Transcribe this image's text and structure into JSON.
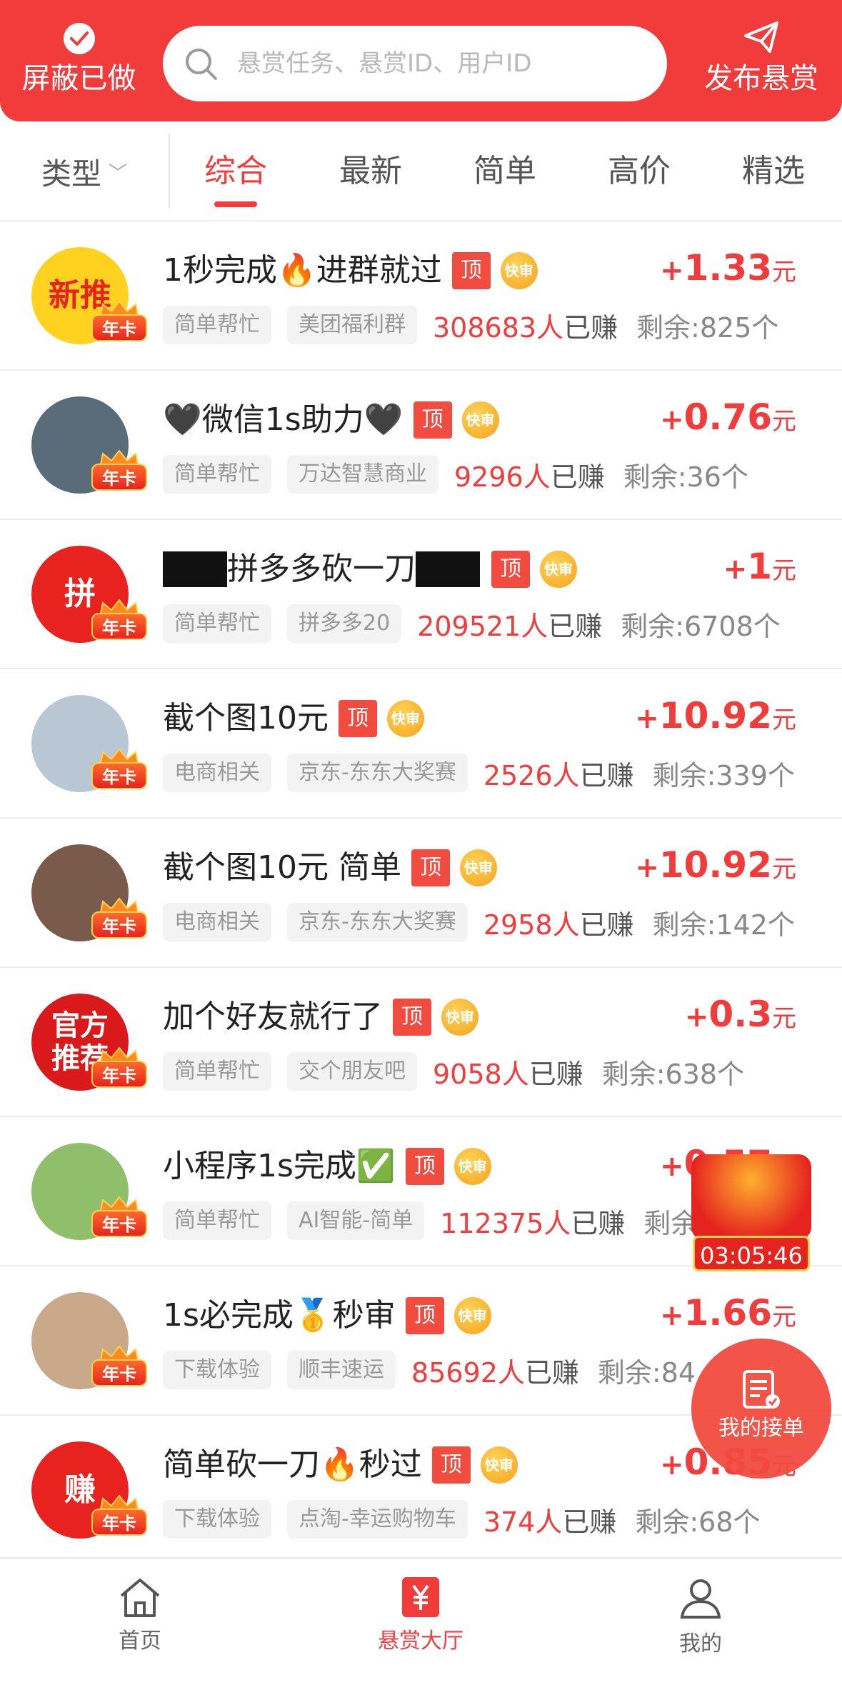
{
  "header": {
    "left_label": "屏蔽已做",
    "search_placeholder": "悬赏任务、悬赏ID、用户ID",
    "right_label": "发布悬赏"
  },
  "filters": {
    "type_label": "类型",
    "tabs": [
      {
        "label": "综合",
        "active": true
      },
      {
        "label": "最新",
        "active": false
      },
      {
        "label": "简单",
        "active": false
      },
      {
        "label": "高价",
        "active": false
      },
      {
        "label": "精选",
        "active": false
      }
    ]
  },
  "badges": {
    "top": "顶",
    "fast": "快审",
    "annual": "年卡"
  },
  "tasks": [
    {
      "title": "1秒完成🔥进群就过",
      "price_plus": "+",
      "price": "1.33",
      "unit": "元",
      "tag1": "简单帮忙",
      "tag2": "美团福利群",
      "earned_count": "308683人",
      "earned_suffix": "已赚",
      "remaining": "剩余:825个",
      "avatar_text": "新推",
      "avatar_color": "#ffd21f"
    },
    {
      "title": "🖤微信1s助力🖤",
      "price_plus": "+",
      "price": "0.76",
      "unit": "元",
      "tag1": "简单帮忙",
      "tag2": "万达智慧商业",
      "earned_count": "9296人",
      "earned_suffix": "已赚",
      "remaining": "剩余:36个",
      "avatar_text": "",
      "avatar_color": "#5a6b7a"
    },
    {
      "title": "拼多多砍一刀",
      "price_plus": "+",
      "price": "1",
      "unit": "元",
      "tag1": "简单帮忙",
      "tag2": "拼多多20",
      "earned_count": "209521人",
      "earned_suffix": "已赚",
      "remaining": "剩余:6708个",
      "avatar_text": "拼",
      "avatar_color": "#e8231f"
    },
    {
      "title": "截个图10元",
      "price_plus": "+",
      "price": "10.92",
      "unit": "元",
      "tag1": "电商相关",
      "tag2": "京东-东东大奖赛",
      "earned_count": "2526人",
      "earned_suffix": "已赚",
      "remaining": "剩余:339个",
      "avatar_text": "",
      "avatar_color": "#b9c6d3"
    },
    {
      "title": "截个图10元 简单",
      "price_plus": "+",
      "price": "10.92",
      "unit": "元",
      "tag1": "电商相关",
      "tag2": "京东-东东大奖赛",
      "earned_count": "2958人",
      "earned_suffix": "已赚",
      "remaining": "剩余:142个",
      "avatar_text": "",
      "avatar_color": "#7a5a4a"
    },
    {
      "title": "加个好友就行了",
      "price_plus": "+",
      "price": "0.3",
      "unit": "元",
      "tag1": "简单帮忙",
      "tag2": "交个朋友吧",
      "earned_count": "9058人",
      "earned_suffix": "已赚",
      "remaining": "剩余:638个",
      "avatar_text": "官方推荐",
      "avatar_color": "#d9191a"
    },
    {
      "title": "小程序1s完成✅",
      "price_plus": "+",
      "price": "0.57",
      "unit": "元",
      "tag1": "简单帮忙",
      "tag2": "AI智能-简单",
      "earned_count": "112375人",
      "earned_suffix": "已赚",
      "remaining": "剩余:",
      "avatar_text": "",
      "avatar_color": "#8fbf6a"
    },
    {
      "title": "1s必完成🥇秒审",
      "price_plus": "+",
      "price": "1.66",
      "unit": "元",
      "tag1": "下载体验",
      "tag2": "顺丰速运",
      "earned_count": "85692人",
      "earned_suffix": "已赚",
      "remaining": "剩余:84",
      "avatar_text": "",
      "avatar_color": "#c9a98a"
    },
    {
      "title": "简单砍一刀🔥秒过",
      "price_plus": "+",
      "price": "0.85",
      "unit": "元",
      "tag1": "下载体验",
      "tag2": "点淘-幸运购物车",
      "earned_count": "374人",
      "earned_suffix": "已赚",
      "remaining": "剩余:68个",
      "avatar_text": "赚",
      "avatar_color": "#e8231f"
    }
  ],
  "floating": {
    "timer": "03:05:46",
    "my_orders": "我的接单"
  },
  "bottom_nav": [
    {
      "label": "首页",
      "icon": "home-icon",
      "active": false
    },
    {
      "label": "悬赏大厅",
      "icon": "yuan-icon",
      "active": true
    },
    {
      "label": "我的",
      "icon": "user-icon",
      "active": false
    }
  ],
  "colors": {
    "brand_red": "#f23c3c",
    "tag_bg": "#f3f3f3",
    "muted": "#888888"
  }
}
